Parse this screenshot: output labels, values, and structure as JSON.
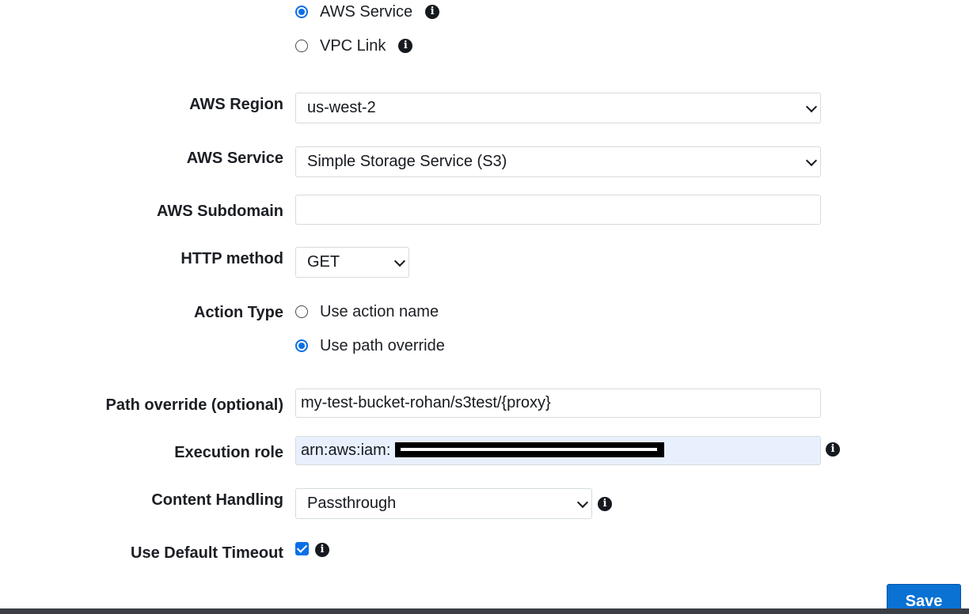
{
  "endpoint_type": {
    "options": [
      {
        "label": "AWS Service",
        "checked": true
      },
      {
        "label": "VPC Link",
        "checked": false
      }
    ]
  },
  "region": {
    "label": "AWS Region",
    "value": "us-west-2"
  },
  "service": {
    "label": "AWS Service",
    "value": "Simple Storage Service (S3)"
  },
  "subdomain": {
    "label": "AWS Subdomain",
    "value": ""
  },
  "http_method": {
    "label": "HTTP method",
    "value": "GET"
  },
  "action_type": {
    "label": "Action Type",
    "options": [
      {
        "label": "Use action name",
        "checked": false
      },
      {
        "label": "Use path override",
        "checked": true
      }
    ]
  },
  "path_override": {
    "label": "Path override (optional)",
    "value": "my-test-bucket-rohan/s3test/{proxy}"
  },
  "execution_role": {
    "label": "Execution role",
    "value": "arn:aws:iam:"
  },
  "content_handling": {
    "label": "Content Handling",
    "value": "Passthrough"
  },
  "default_timeout": {
    "label": "Use Default Timeout",
    "checked": true
  },
  "save": {
    "label": "Save"
  },
  "colors": {
    "accent": "#0b6fe5",
    "button": "#0972d3",
    "autofill": "#e8f0fe"
  },
  "icons": {
    "info": "info-icon",
    "dropdown": "chevron-down-icon",
    "check": "check-icon"
  }
}
